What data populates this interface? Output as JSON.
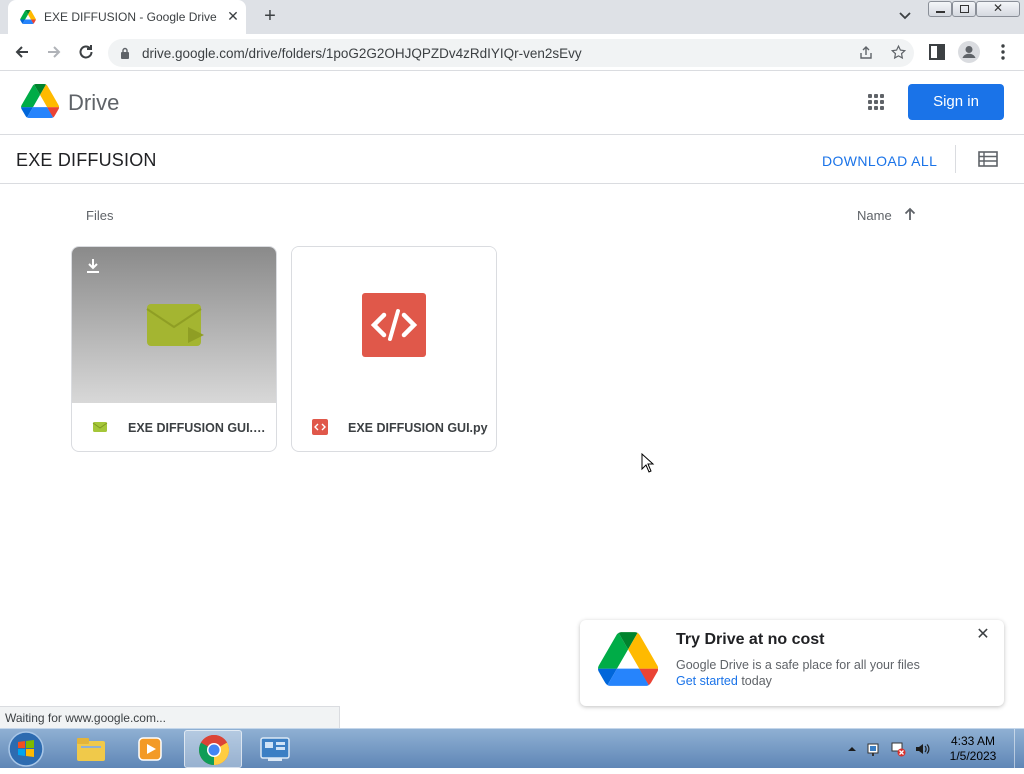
{
  "browser": {
    "tab_title": "EXE DIFFUSION - Google Drive",
    "tab_close": "✕",
    "new_tab": "+",
    "url": "drive.google.com/drive/folders/1poG2G2OHJQPZDv4zRdIYIQr-ven2sEvy"
  },
  "drive": {
    "app_name": "Drive",
    "sign_in_label": "Sign in",
    "folder_title": "EXE DIFFUSION",
    "download_all_label": "DOWNLOAD ALL",
    "files_heading": "Files",
    "sort_label": "Name"
  },
  "files": [
    {
      "name": "EXE DIFFUSION GUI.exe",
      "display_name": "EXE DIFFUSION GUI.e...",
      "type": "exe",
      "icon": "video-file-icon"
    },
    {
      "name": "EXE DIFFUSION GUI.py",
      "display_name": "EXE DIFFUSION GUI.py",
      "type": "code",
      "icon": "code-file-icon"
    }
  ],
  "promo": {
    "title": "Try Drive at no cost",
    "description": "Google Drive is a safe place for all your files",
    "link_label": "Get started",
    "link_suffix": " today",
    "close": "✕"
  },
  "status_bar": "Waiting for www.google.com...",
  "taskbar": {
    "time": "4:33 AM",
    "date": "1/5/2023"
  },
  "colors": {
    "primary_blue": "#1a73e8",
    "code_red": "#e0584a",
    "exe_green": "#a4b531"
  }
}
